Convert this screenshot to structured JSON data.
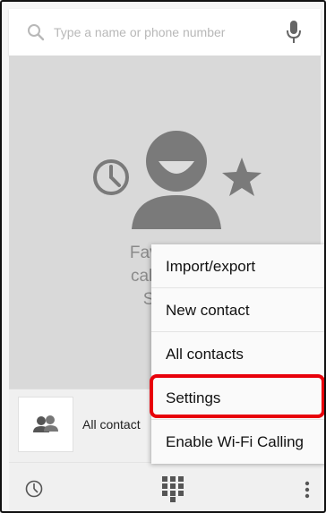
{
  "search": {
    "placeholder": "Type a name or phone number",
    "search_icon": "search-icon",
    "mic_icon": "microphone-icon"
  },
  "empty_state": {
    "hero_icons": [
      "clock-icon",
      "person-icon",
      "star-icon"
    ],
    "line1": "Favorites",
    "line2": "call often",
    "line3": "So, st"
  },
  "contact_bar": {
    "avatar_icon": "contacts-group-icon",
    "label": "All contact"
  },
  "bottom_nav": {
    "items": [
      "history-clock-icon",
      "dialpad-icon",
      "more-vert-icon"
    ]
  },
  "menu": {
    "items": [
      {
        "label": "Import/export"
      },
      {
        "label": "New contact"
      },
      {
        "label": "All contacts"
      },
      {
        "label": "Settings"
      },
      {
        "label": "Enable Wi-Fi Calling"
      }
    ],
    "highlighted_index": 3,
    "highlight_color": "#e8000a"
  }
}
